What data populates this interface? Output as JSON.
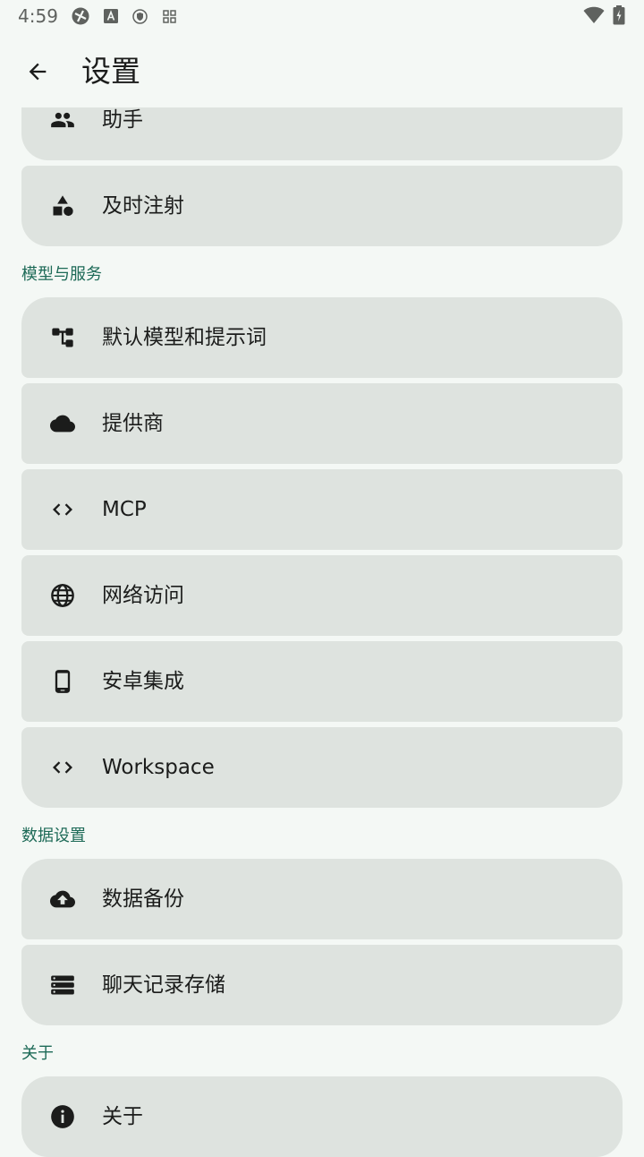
{
  "status_bar": {
    "time": "4:59",
    "left_icons": [
      "sync-icon",
      "font-a-icon",
      "shield-icon",
      "grid-icon"
    ],
    "right_icons": [
      "wifi-icon",
      "battery-charging-icon"
    ]
  },
  "app_bar": {
    "back_icon": "arrow-left-icon",
    "title": "设置"
  },
  "sections": {
    "assistant_group": {
      "items": [
        {
          "label": "助手",
          "icon": "people-icon"
        },
        {
          "label": "及时注射",
          "icon": "shapes-icon"
        }
      ]
    },
    "models_services": {
      "header": "模型与服务",
      "items": [
        {
          "label": "默认模型和提示词",
          "icon": "hierarchy-icon"
        },
        {
          "label": "提供商",
          "icon": "cloud-icon"
        },
        {
          "label": "MCP",
          "icon": "code-icon"
        },
        {
          "label": "网络访问",
          "icon": "globe-icon"
        },
        {
          "label": "安卓集成",
          "icon": "phone-icon"
        },
        {
          "label": "Workspace",
          "icon": "code-icon"
        }
      ]
    },
    "data_settings": {
      "header": "数据设置",
      "items": [
        {
          "label": "数据备份",
          "icon": "cloud-upload-icon"
        },
        {
          "label": "聊天记录存储",
          "icon": "storage-icon"
        }
      ]
    },
    "about": {
      "header": "关于",
      "items": [
        {
          "label": "关于",
          "icon": "info-icon"
        }
      ]
    }
  },
  "colors": {
    "background": "#f4f8f5",
    "card": "#dee3df",
    "section_header": "#1d6a57",
    "text": "#1b1c1b",
    "icon": "#1b1c1b"
  }
}
